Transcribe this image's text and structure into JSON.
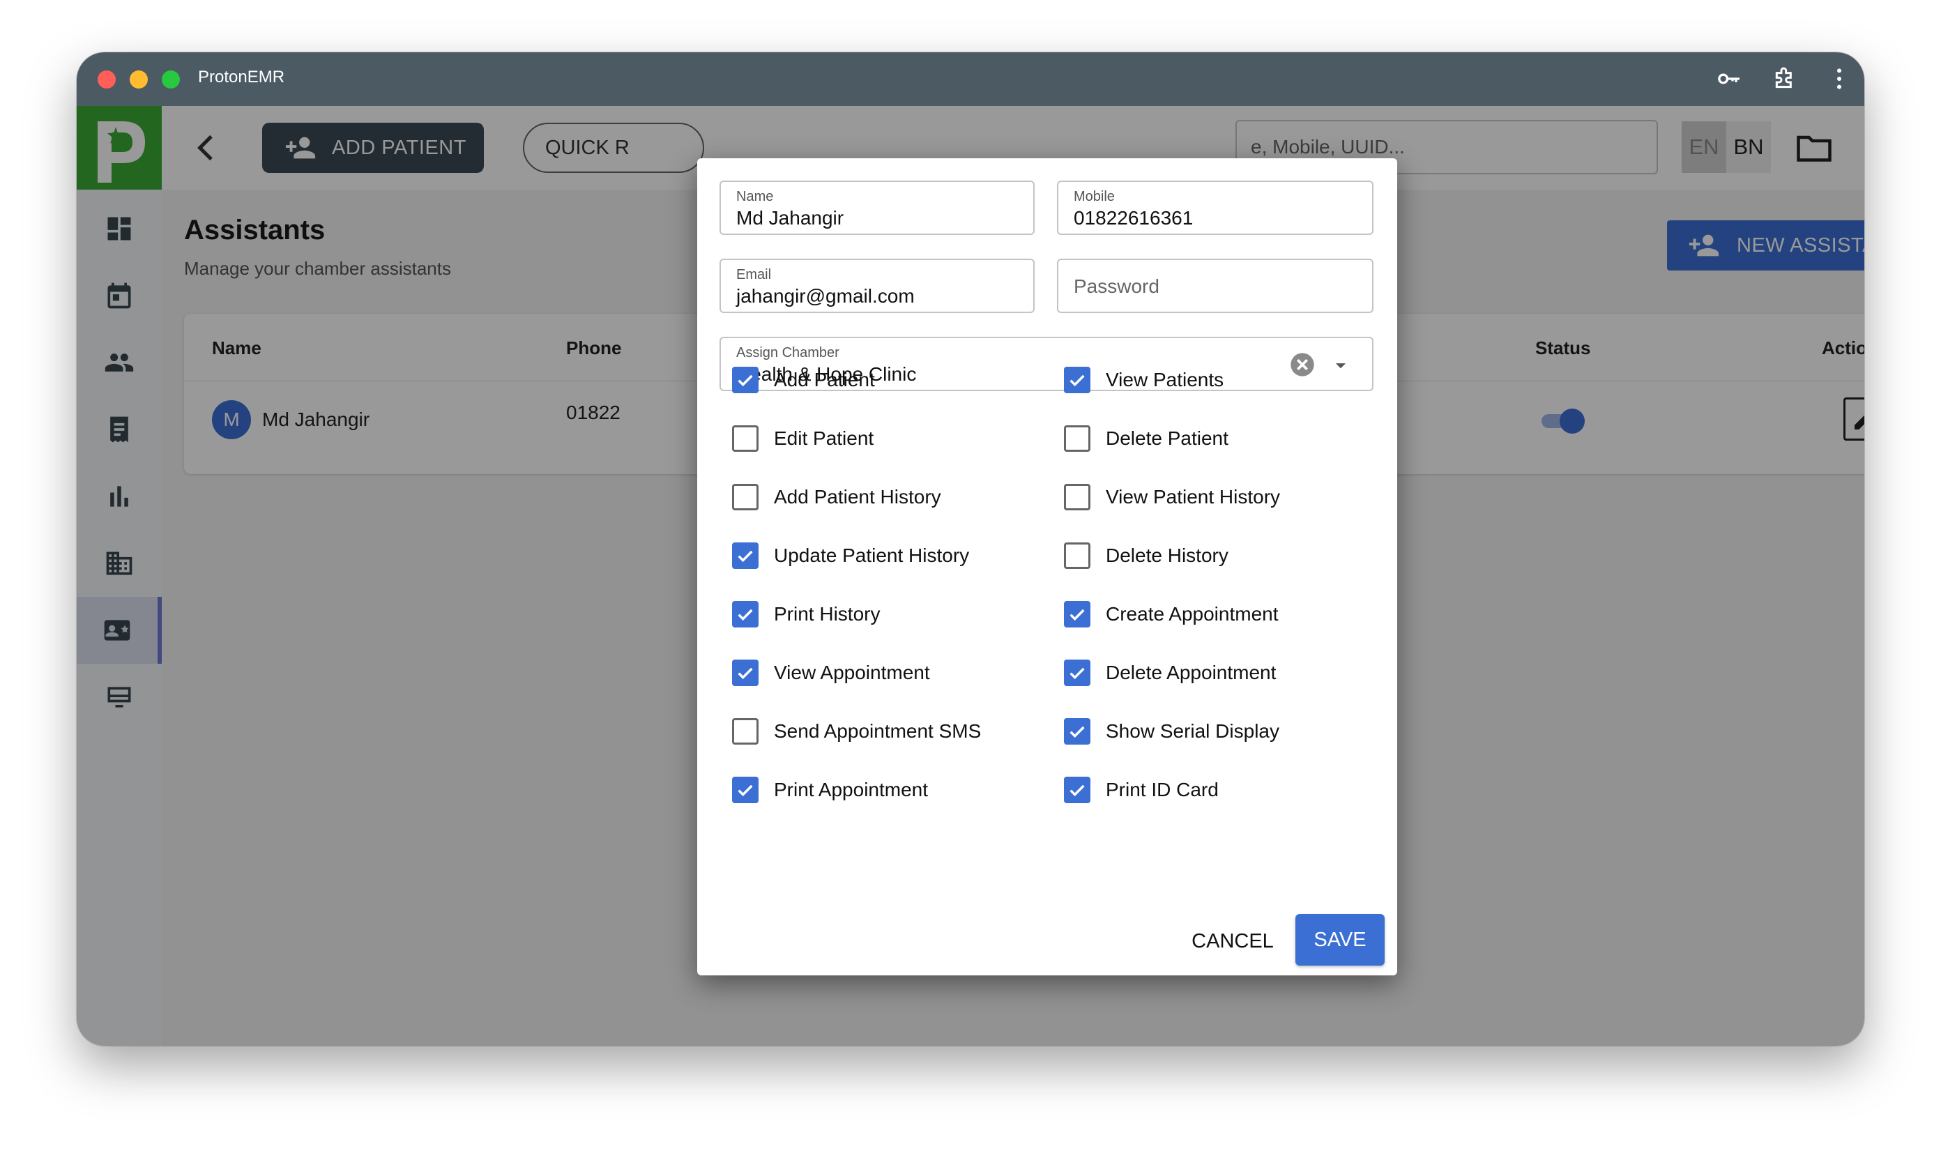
{
  "window": {
    "title": "ProtonEMR"
  },
  "topbar": {
    "add_patient_label": "ADD PATIENT",
    "quick_label": "QUICK R",
    "search_placeholder": "e, Mobile, UUID...",
    "lang_en": "EN",
    "lang_bn": "BN"
  },
  "page": {
    "title": "Assistants",
    "subtitle": "Manage your chamber assistants",
    "new_assistant_label": "NEW ASSISTANT"
  },
  "table": {
    "headers": {
      "name": "Name",
      "phone": "Phone",
      "status": "Status",
      "actions": "Actions"
    },
    "rows": [
      {
        "avatar_initial": "M",
        "name": "Md Jahangir",
        "phone": "01822",
        "status_on": true
      }
    ]
  },
  "dialog": {
    "name": {
      "label": "Name",
      "value": "Md Jahangir"
    },
    "mobile": {
      "label": "Mobile",
      "value": "01822616361"
    },
    "email": {
      "label": "Email",
      "value": "jahangir@gmail.com"
    },
    "password": {
      "placeholder": "Password"
    },
    "chamber": {
      "label": "Assign Chamber",
      "value": "Health & Hope Clinic"
    },
    "permissions": [
      {
        "label": "Add Patient",
        "checked": true
      },
      {
        "label": "View Patients",
        "checked": true
      },
      {
        "label": "Edit Patient",
        "checked": false
      },
      {
        "label": "Delete Patient",
        "checked": false
      },
      {
        "label": "Add Patient History",
        "checked": false
      },
      {
        "label": "View Patient History",
        "checked": false
      },
      {
        "label": "Update Patient History",
        "checked": true
      },
      {
        "label": "Delete History",
        "checked": false
      },
      {
        "label": "Print History",
        "checked": true
      },
      {
        "label": "Create Appointment",
        "checked": true
      },
      {
        "label": "View Appointment",
        "checked": true
      },
      {
        "label": "Delete Appointment",
        "checked": true
      },
      {
        "label": "Send Appointment SMS",
        "checked": false
      },
      {
        "label": "Show Serial Display",
        "checked": true
      },
      {
        "label": "Print Appointment",
        "checked": true
      },
      {
        "label": "Print ID Card",
        "checked": true
      }
    ],
    "cancel_label": "CANCEL",
    "save_label": "SAVE"
  },
  "colors": {
    "accent": "#3b6fd4",
    "titlebar": "#4c5a64",
    "brand_green": "#3aaa35"
  }
}
